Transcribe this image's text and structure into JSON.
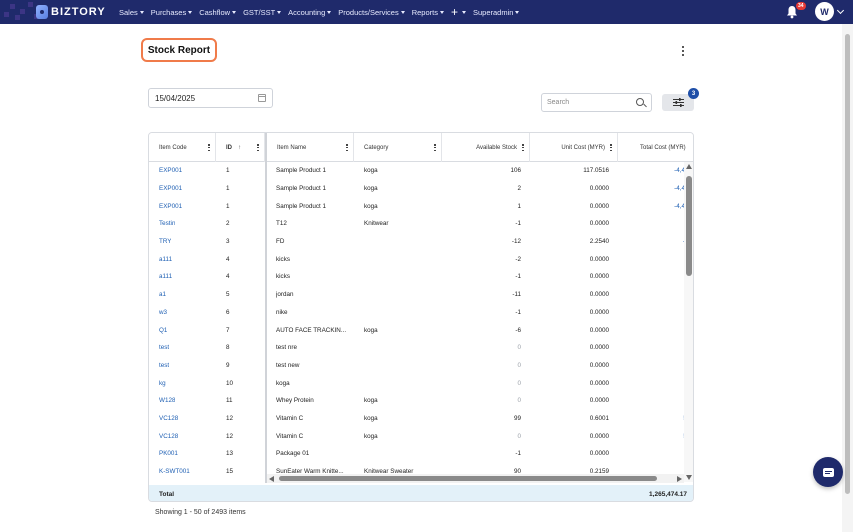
{
  "nav": {
    "brand": "BIZTORY",
    "menu": [
      "Sales",
      "Purchases",
      "Cashflow",
      "GST/SST",
      "Accounting",
      "Products/Services",
      "Reports",
      "+",
      "Superadmin"
    ],
    "notification_count": "34",
    "user_initial": "W"
  },
  "page": {
    "title": "Stock Report",
    "date_value": "15/04/2025",
    "search_placeholder": "Search",
    "filter_count": "3"
  },
  "table": {
    "columns": {
      "code": "Item Code",
      "id": "ID",
      "name": "Item Name",
      "category": "Category",
      "stock": "Available Stock",
      "cost": "Unit Cost (MYR)",
      "total": "Total Cost (MYR)"
    },
    "rows": [
      {
        "code": "EXP001",
        "id": "1",
        "name": "Sample Product 1",
        "category": "koga",
        "stock": "106",
        "cost": "117.0516",
        "total": "-4,4"
      },
      {
        "code": "EXP001",
        "id": "1",
        "name": "Sample Product 1",
        "category": "koga",
        "stock": "2",
        "cost": "0.0000",
        "total": "-4,4"
      },
      {
        "code": "EXP001",
        "id": "1",
        "name": "Sample Product 1",
        "category": "koga",
        "stock": "1",
        "cost": "0.0000",
        "total": "-4,4"
      },
      {
        "code": "Testin",
        "id": "2",
        "name": "T12",
        "category": "Knitwear",
        "stock": "-1",
        "cost": "0.0000",
        "total": ""
      },
      {
        "code": "TRY",
        "id": "3",
        "name": "FD",
        "category": "",
        "stock": "-12",
        "cost": "2.2540",
        "total": "-"
      },
      {
        "code": "a111",
        "id": "4",
        "name": "kicks",
        "category": "",
        "stock": "-2",
        "cost": "0.0000",
        "total": ""
      },
      {
        "code": "a111",
        "id": "4",
        "name": "kicks",
        "category": "",
        "stock": "-1",
        "cost": "0.0000",
        "total": ""
      },
      {
        "code": "a1",
        "id": "5",
        "name": "jordan",
        "category": "",
        "stock": "-11",
        "cost": "0.0000",
        "total": ""
      },
      {
        "code": "w3",
        "id": "6",
        "name": "nike",
        "category": "",
        "stock": "-1",
        "cost": "0.0000",
        "total": ""
      },
      {
        "code": "Q1",
        "id": "7",
        "name": "AUTO FACE TRACKIN...",
        "category": "koga",
        "stock": "-6",
        "cost": "0.0000",
        "total": ""
      },
      {
        "code": "test",
        "id": "8",
        "name": "test nre",
        "category": "",
        "stock": "0",
        "cost": "0.0000",
        "total": ""
      },
      {
        "code": "test",
        "id": "9",
        "name": "test new",
        "category": "",
        "stock": "0",
        "cost": "0.0000",
        "total": ""
      },
      {
        "code": "kg",
        "id": "10",
        "name": "koga",
        "category": "",
        "stock": "0",
        "cost": "0.0000",
        "total": ""
      },
      {
        "code": "W128",
        "id": "11",
        "name": "Whey Protein",
        "category": "koga",
        "stock": "0",
        "cost": "0.0000",
        "total": ""
      },
      {
        "code": "VC128",
        "id": "12",
        "name": "Vitamin C",
        "category": "koga",
        "stock": "99",
        "cost": "0.6001",
        "total": "!"
      },
      {
        "code": "VC128",
        "id": "12",
        "name": "Vitamin C",
        "category": "koga",
        "stock": "0",
        "cost": "0.0000",
        "total": "!"
      },
      {
        "code": "PK001",
        "id": "13",
        "name": "Package 01",
        "category": "",
        "stock": "-1",
        "cost": "0.0000",
        "total": ""
      },
      {
        "code": "K-SWT001",
        "id": "15",
        "name": "SunEater Warm Knitte...",
        "category": "Knitwear Sweater",
        "stock": "90",
        "cost": "0.2159",
        "total": ""
      }
    ],
    "total_label": "Total",
    "total_value": "1,265,474.17"
  },
  "footer": {
    "showing": "Showing 1 - 50 of 2493 items"
  }
}
